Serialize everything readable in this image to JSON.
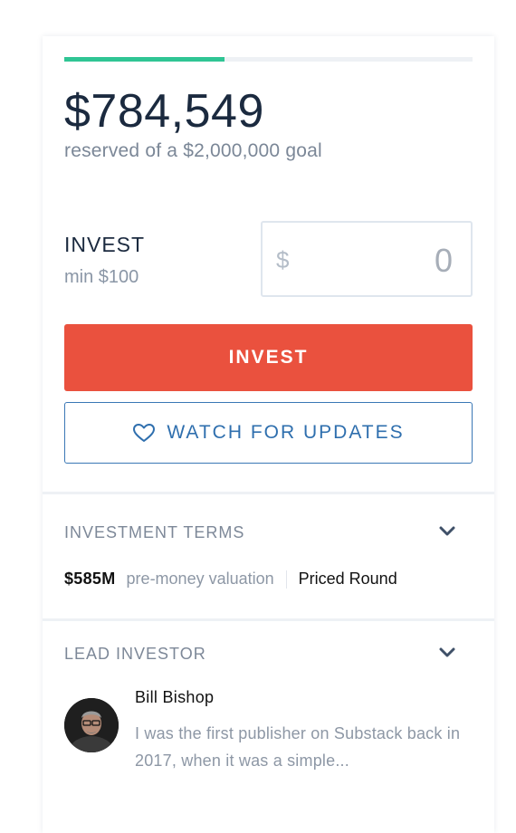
{
  "funding": {
    "amount_raised": "$784,549",
    "goal_text": "reserved of a $2,000,000 goal",
    "progress_fraction": 0.392,
    "progress_color": "#2fc594"
  },
  "invest": {
    "label": "INVEST",
    "min_text": "min $100",
    "currency_symbol": "$",
    "amount_value": "0",
    "button_label": "INVEST",
    "button_color": "#ea513e"
  },
  "watch": {
    "label": "WATCH FOR UPDATES",
    "icon": "heart-outline-icon",
    "accent": "#2f6fae"
  },
  "terms": {
    "title": "INVESTMENT TERMS",
    "valuation": "$585M",
    "valuation_label": "pre-money valuation",
    "round_type": "Priced Round"
  },
  "lead_investor": {
    "title": "LEAD INVESTOR",
    "name": "Bill Bishop",
    "bio": "I was the first publisher on Substack back in 2017, when it was a simple..."
  }
}
